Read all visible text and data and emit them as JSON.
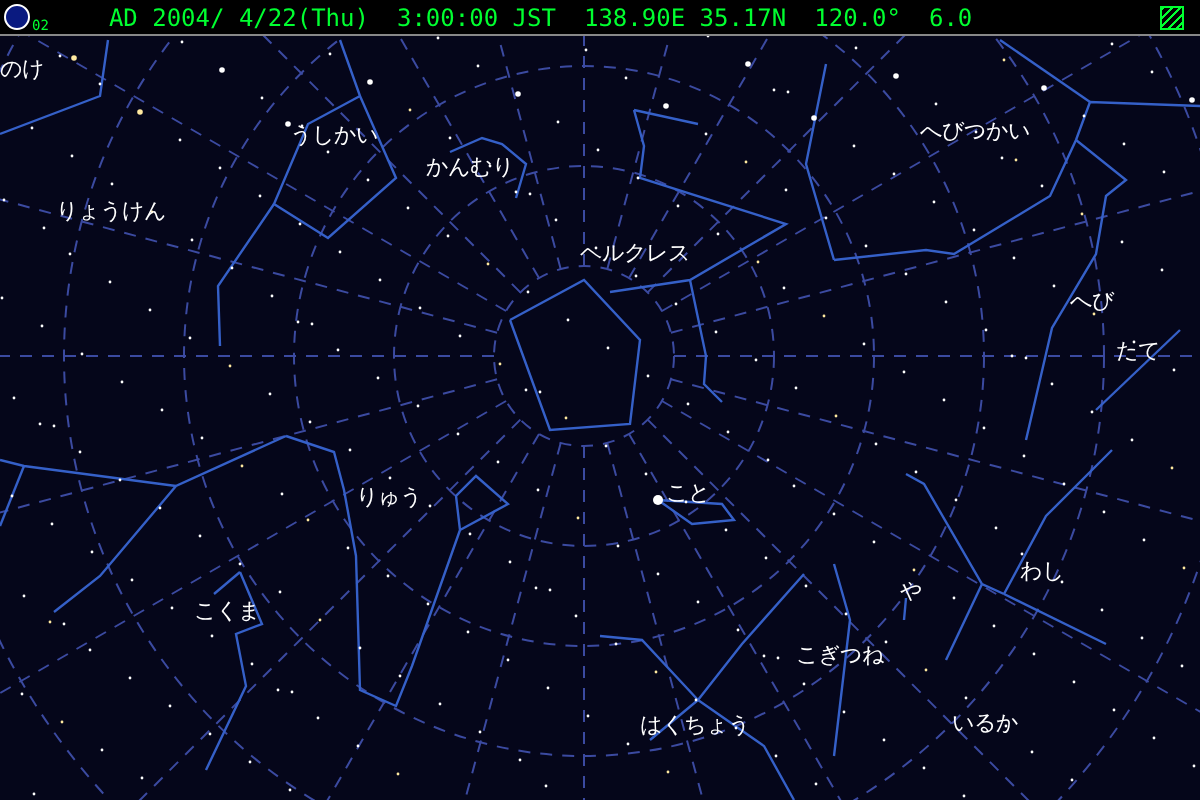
{
  "status_bar": {
    "moon_age": "02",
    "date": "AD 2004/ 4/22(Thu)",
    "time": "3:00:00 JST",
    "location": "138.90E 35.17N",
    "angle": "120.0°",
    "magnitude": "6.0"
  },
  "constellation_labels": [
    "のけ",
    "うしかい",
    "かんむり",
    "りょうけん",
    "ヘルクレス",
    "へびつかい",
    "へび",
    "たて",
    "りゅう",
    "こと",
    "わし",
    "こくま",
    "や",
    "こぎつね",
    "はくちょう",
    "いるか"
  ]
}
